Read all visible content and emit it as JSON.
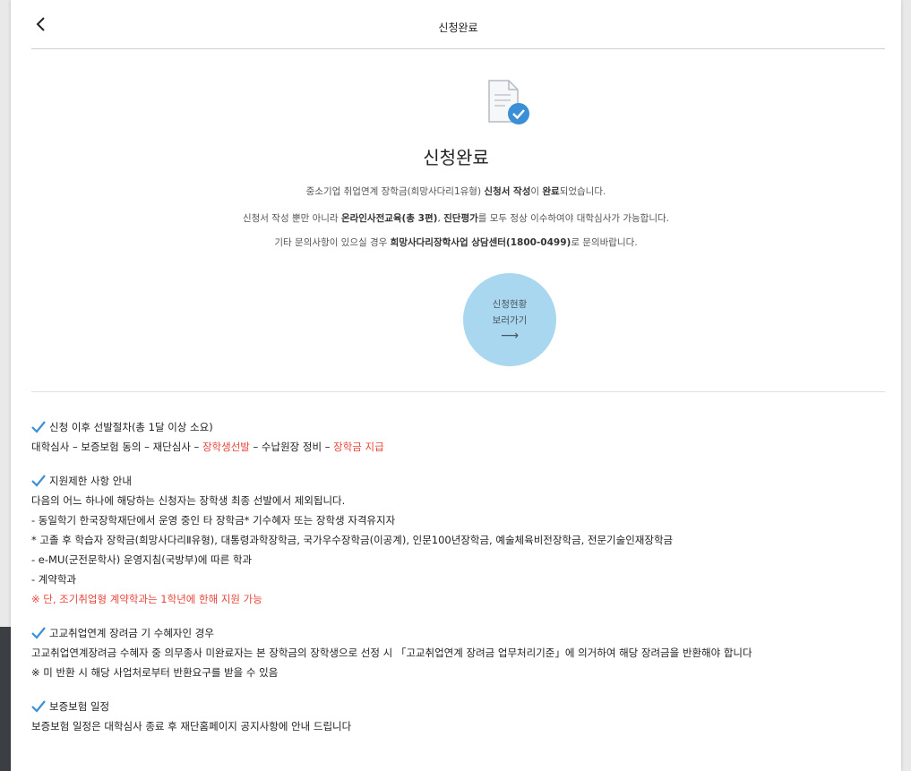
{
  "header": {
    "title": "신청완료",
    "back_label": "<"
  },
  "complete": {
    "title": "신청완료",
    "msg1": {
      "pre": "중소기업 취업연계 장학금(희망사다리1유형) ",
      "b1": "신청서 작성",
      "mid": "이 ",
      "b2": "완료",
      "post": "되었습니다."
    },
    "msg2": {
      "pre": "신청서 작성 뿐만 아니라 ",
      "b1": "온라인사전교육(총 3편)",
      "mid": ", ",
      "b2": "진단평가",
      "post": "를 모두 정상 이수하여야 대학심사가 가능합니다."
    },
    "msg3": {
      "pre": "기타 문의사항이 있으실 경우 ",
      "b1": "희망사다리장학사업 상담센터(1800-0499)",
      "post": "로 문의바랍니다."
    }
  },
  "status_button": {
    "line1": "신청현황",
    "line2": "보러가기",
    "arrow": "⟶"
  },
  "sections": {
    "s1": {
      "heading": "신청 이후 선발절차(총 1달 이상 소요)",
      "p1": "대학심사 – 보증보험 동의 – 재단심사 – ",
      "p2_red": "장학생선발",
      "p3": " – 수납원장 정비 – ",
      "p4_red": "장학금 지급"
    },
    "s2": {
      "heading": "지원제한 사항 안내",
      "lines": [
        "다음의 어느 하나에 해당하는 신청자는 장학생 최종 선발에서 제외됩니다.",
        "- 동일학기 한국장학재단에서 운영 중인 타 장학금* 기수혜자 또는 장학생 자격유지자",
        "* 고졸 후 학습자 장학금(희망사다리Ⅱ유형), 대통령과학장학금, 국가우수장학금(이공계), 인문100년장학금, 예술체육비전장학금, 전문기술인재장학금",
        "- e-MU(군전문학사) 운영지침(국방부)에 따른 학과",
        "- 계약학과"
      ],
      "note_red": "※ 단, 조기취업형 계약학과는 1학년에 한해 지원 가능"
    },
    "s3": {
      "heading": "고교취업연계 장려금 기 수혜자인 경우",
      "lines": [
        "고교취업연계장려금 수혜자 중 의무종사 미완료자는 본 장학금의 장학생으로 선정 시 「고교취업연계 장려금 업무처리기준」에 의거하여 해당 장려금을 반환해야 합니다",
        "※ 미 반환 시 해당 사업처로부터 반환요구를 받을 수 있음"
      ]
    },
    "s4": {
      "heading": "보증보험 일정",
      "line": "보증보험 일정은 대학심사 종료 후 재단홈페이지 공지사항에 안내 드립니다"
    }
  },
  "colors": {
    "accent_blue": "#3a8fd6",
    "red": "#e8463b",
    "circle": "#a9d7ef"
  },
  "icons": [
    "chevron-left-icon",
    "document-check-icon",
    "checkmark-icon"
  ]
}
